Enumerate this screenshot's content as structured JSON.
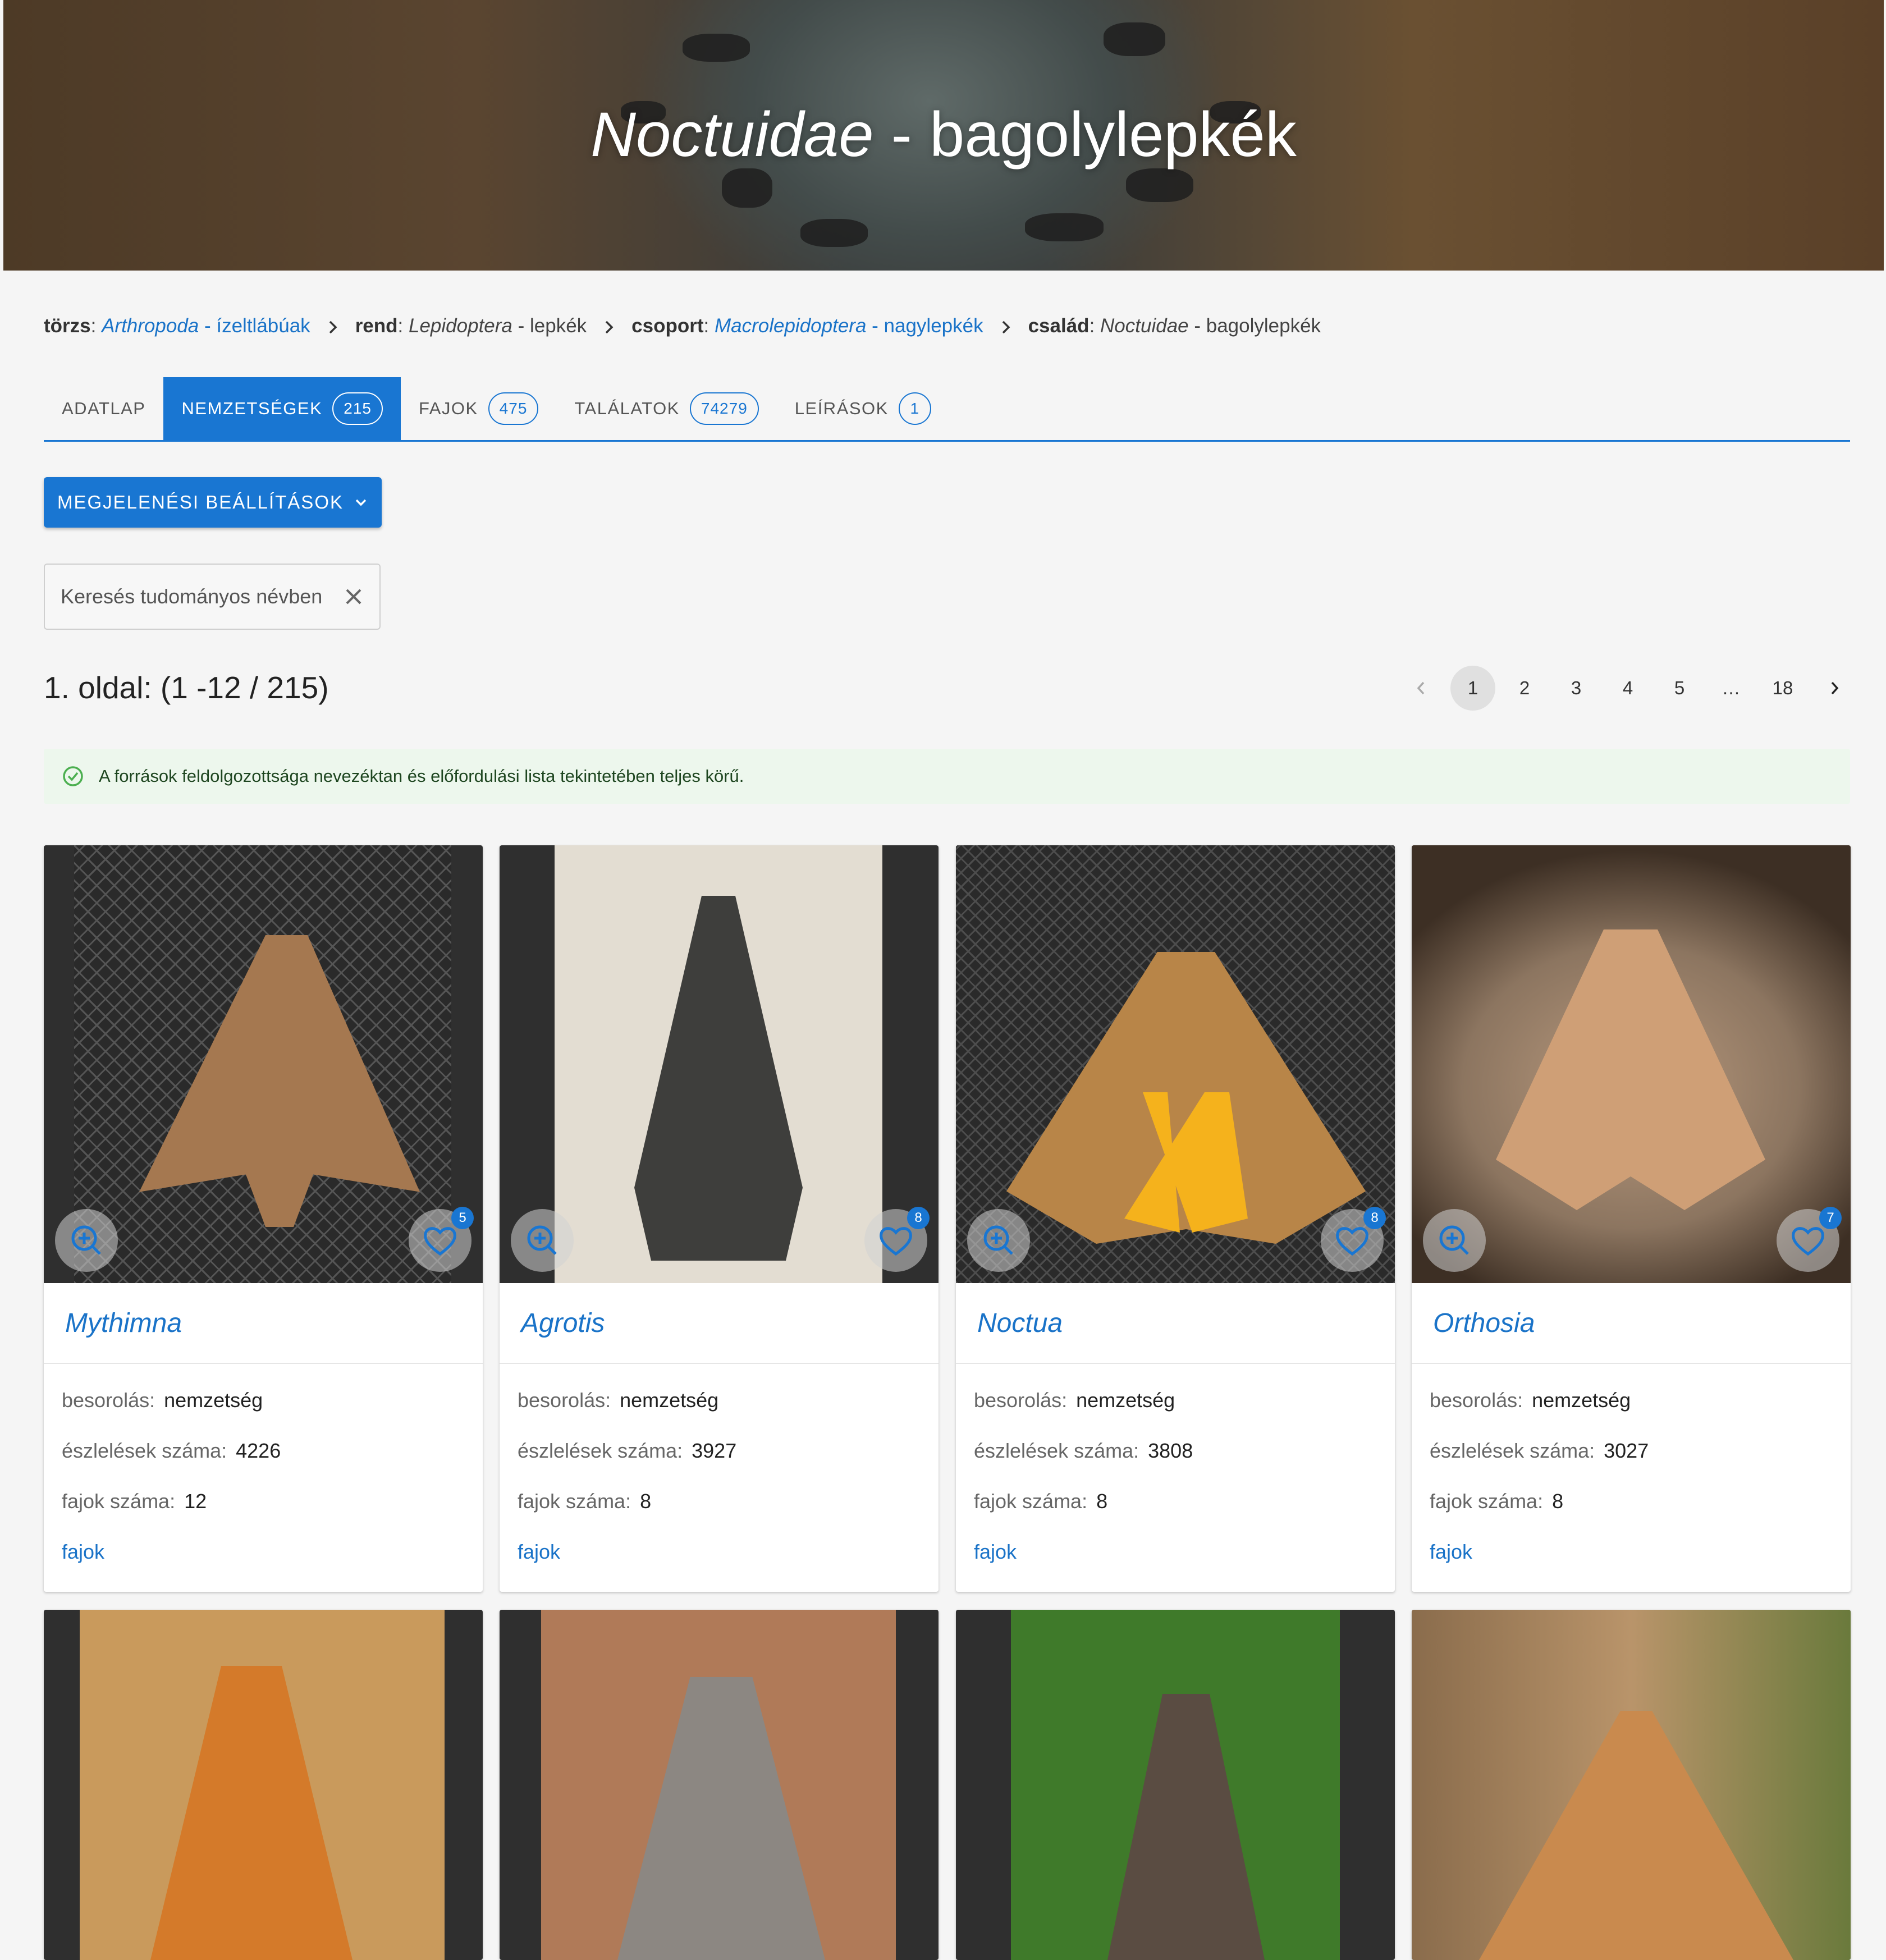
{
  "hero": {
    "title_italic": "Noctuidae",
    "title_rest": " - bagolylepkék"
  },
  "breadcrumb": [
    {
      "label": "törzs",
      "sci": "Arthropoda",
      "common": " - ízeltlábúak",
      "link": true
    },
    {
      "label": "rend",
      "sci": "Lepidoptera",
      "common": " - lepkék",
      "link": false
    },
    {
      "label": "csoport",
      "sci": "Macrolepidoptera",
      "common": " - nagylepkék",
      "link": true
    },
    {
      "label": "család",
      "sci": "Noctuidae",
      "common": " - bagolylepkék",
      "link": false
    }
  ],
  "tabs": [
    {
      "label": "ADATLAP",
      "count": "",
      "active": false
    },
    {
      "label": "NEMZETSÉGEK",
      "count": "215",
      "active": true
    },
    {
      "label": "FAJOK",
      "count": "475",
      "active": false
    },
    {
      "label": "TALÁLATOK",
      "count": "74279",
      "active": false
    },
    {
      "label": "LEÍRÁSOK",
      "count": "1",
      "active": false
    }
  ],
  "settings_button": "MEGJELENÉSI BEÁLLÍTÁSOK",
  "search": {
    "placeholder": "Keresés tudományos névben",
    "value": ""
  },
  "page_info": "1. oldal: (1 -12 / 215)",
  "pagination": {
    "pages": [
      "1",
      "2",
      "3",
      "4",
      "5",
      "…",
      "18"
    ],
    "current": "1"
  },
  "alert": "A források feldolgozottsága nevezéktan és előfordulási lista tekintetében teljes körű.",
  "labels": {
    "classification": "besorolás:",
    "observations": "észlelések száma:",
    "species_count": "fajok száma:",
    "species_link": "fajok"
  },
  "cards": [
    {
      "name": "Mythimna",
      "classification": "nemzetség",
      "observations": "4226",
      "species": "12",
      "favorites": "5"
    },
    {
      "name": "Agrotis",
      "classification": "nemzetség",
      "observations": "3927",
      "species": "8",
      "favorites": "8"
    },
    {
      "name": "Noctua",
      "classification": "nemzetség",
      "observations": "3808",
      "species": "8",
      "favorites": "8"
    },
    {
      "name": "Orthosia",
      "classification": "nemzetség",
      "observations": "3027",
      "species": "8",
      "favorites": "7"
    }
  ],
  "colors": {
    "primary": "#1976d2",
    "link": "#1a73c8",
    "alert_bg": "#edf7ed",
    "alert_icon": "#4caf50"
  },
  "icons": [
    "chevron-right-icon",
    "chevron-down-icon",
    "close-icon",
    "chevron-left-icon",
    "check-circle-icon",
    "zoom-in-icon",
    "heart-icon"
  ]
}
